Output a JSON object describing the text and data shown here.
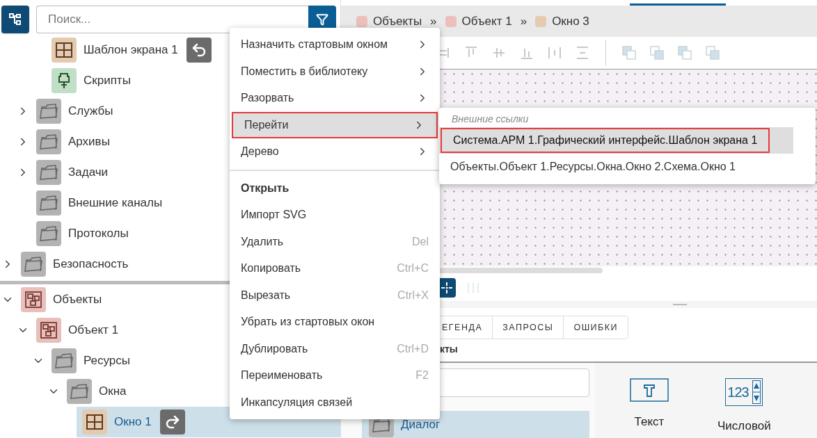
{
  "search": {
    "placeholder": "Поиск..."
  },
  "top_tree": {
    "children": [
      {
        "children": [
          {
            "children": [
              {
                "label": "Шаблон экрана 1",
                "kind": "screen",
                "selected": false,
                "link_badge": {
                  "kind": "back"
                }
              },
              {
                "label": "Скрипты",
                "kind": "script",
                "selected": false
              }
            ]
          },
          {
            "label": "Службы",
            "kind": "folder",
            "expanded": false,
            "selected": false
          },
          {
            "label": "Архивы",
            "kind": "folder",
            "expanded": false,
            "selected": false
          },
          {
            "label": "Задачи",
            "kind": "folder",
            "expanded": false,
            "selected": false
          },
          {
            "label": "Внешние каналы",
            "kind": "folder",
            "selected": false
          },
          {
            "label": "Протоколы",
            "kind": "folder",
            "selected": false
          }
        ]
      },
      {
        "label": "Безопасность",
        "kind": "folder",
        "expanded": false,
        "selected": false
      }
    ]
  },
  "objects_tree": [
    {
      "label": "Объекты",
      "kind": "objects",
      "expanded": true,
      "selected": false,
      "children": [
        {
          "label": "Объект 1",
          "kind": "object",
          "expanded": true,
          "selected": false,
          "children": [
            {
              "label": "Ресурсы",
              "kind": "folder",
              "expanded": true,
              "selected": false,
              "children": [
                {
                  "label": "Окна",
                  "kind": "folder",
                  "expanded": true,
                  "selected": false,
                  "children": [
                    {
                      "label": "Окно 1",
                      "kind": "screen",
                      "selected": true,
                      "link_badge": {
                        "kind": "forward"
                      }
                    }
                  ]
                }
              ]
            }
          ]
        }
      ]
    }
  ],
  "breadcrumbs": [
    {
      "label": "Объекты",
      "color": "#ebc0bc"
    },
    {
      "label": "Объект 1",
      "color": "#ebc0bc"
    },
    {
      "label": "Окно 3",
      "color": "#e4cbb0"
    }
  ],
  "breadcrumb_separators": [
    "»",
    "»"
  ],
  "bottom_tabs": [
    {
      "label": "ЕГЕНДА",
      "selected": false
    },
    {
      "label": "ЗАПРОСЫ",
      "selected": false
    },
    {
      "label": "ОШИБКИ",
      "selected": false
    }
  ],
  "sub_tab": "кты",
  "library_items": [
    {
      "label": "Диалог",
      "kind": "folder",
      "selected": true
    }
  ],
  "palette": [
    {
      "label": "Текст",
      "kind": "text"
    },
    {
      "label": "Числовой",
      "kind": "numeric",
      "glyph": "123"
    }
  ],
  "context_menu": {
    "groups": [
      [
        {
          "label": "Назначить стартовым окном",
          "submenu": true,
          "selected": false,
          "default": false
        },
        {
          "label": "Поместить в библиотеку",
          "submenu": true,
          "selected": false,
          "default": false
        },
        {
          "label": "Разорвать",
          "submenu": true,
          "selected": false,
          "default": false
        },
        {
          "label": "Перейти",
          "submenu": true,
          "selected": true,
          "default": false
        },
        {
          "label": "Дерево",
          "submenu": true,
          "selected": false,
          "default": false
        }
      ],
      [
        {
          "label": "Открыть",
          "submenu": false,
          "selected": false,
          "default": true
        },
        {
          "label": "Импорт SVG",
          "submenu": false,
          "selected": false,
          "default": false
        },
        {
          "label": "Удалить",
          "shortcut": "Del",
          "submenu": false,
          "selected": false,
          "default": false
        },
        {
          "label": "Копировать",
          "shortcut": "Ctrl+C",
          "submenu": false,
          "selected": false,
          "default": false
        },
        {
          "label": "Вырезать",
          "shortcut": "Ctrl+X",
          "submenu": false,
          "selected": false,
          "default": false
        },
        {
          "label": "Убрать из стартовых окон",
          "submenu": false,
          "selected": false,
          "default": false
        },
        {
          "label": "Дублировать",
          "shortcut": "Ctrl+D",
          "submenu": false,
          "selected": false,
          "default": false
        },
        {
          "label": "Переименовать",
          "shortcut": "F2",
          "submenu": false,
          "selected": false,
          "default": false
        },
        {
          "label": "Инкапсуляция связей",
          "submenu": false,
          "selected": false,
          "default": false
        }
      ]
    ]
  },
  "submenu": {
    "header": "Внешние ссылки",
    "items": [
      {
        "label": "Система.АРМ 1.Графический интерфейс.Шаблон экрана 1",
        "selected": true
      },
      {
        "label": "Объекты.Объект 1.Ресурсы.Окна.Окно 2.Схема.Окно 1",
        "selected": false
      }
    ]
  }
}
